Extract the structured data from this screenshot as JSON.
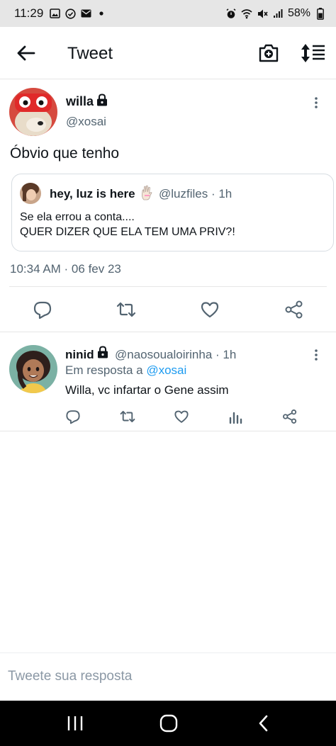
{
  "status_bar": {
    "time": "11:29",
    "battery": "58%",
    "left_icons": [
      "image-icon",
      "check-circle-icon",
      "mail-icon",
      "dot-icon"
    ],
    "right_icons": [
      "alarm-icon",
      "wifi-off-icon",
      "mute-icon",
      "signal-icon",
      "battery-icon"
    ]
  },
  "app_bar": {
    "title": "Tweet"
  },
  "tweet": {
    "author_name": "willa",
    "author_handle": "@xosai",
    "text": "Óbvio que tenho",
    "timestamp": "10:34 AM · 06 fev 23",
    "quoted": {
      "name": "hey, luz is here",
      "handle_time": "@luzfiles · 1h",
      "text_line_1": "Se ela errou a conta....",
      "text_line_2": "QUER DIZER QUE ELA TEM UMA PRIV?!"
    }
  },
  "reply": {
    "author_name": "ninid",
    "author_handle_time": "@naosoualoirinha · 1h",
    "replying_prefix": "Em resposta a",
    "replying_to": "@xosai",
    "text": "Willa, vc infartar o Gene assim"
  },
  "compose": {
    "placeholder": "Tweete sua resposta"
  },
  "colors": {
    "accent": "#1d9bf0",
    "secondary_text": "#536471",
    "status_bar_bg": "#e6e6e6",
    "nav_bar_bg": "#000000"
  }
}
